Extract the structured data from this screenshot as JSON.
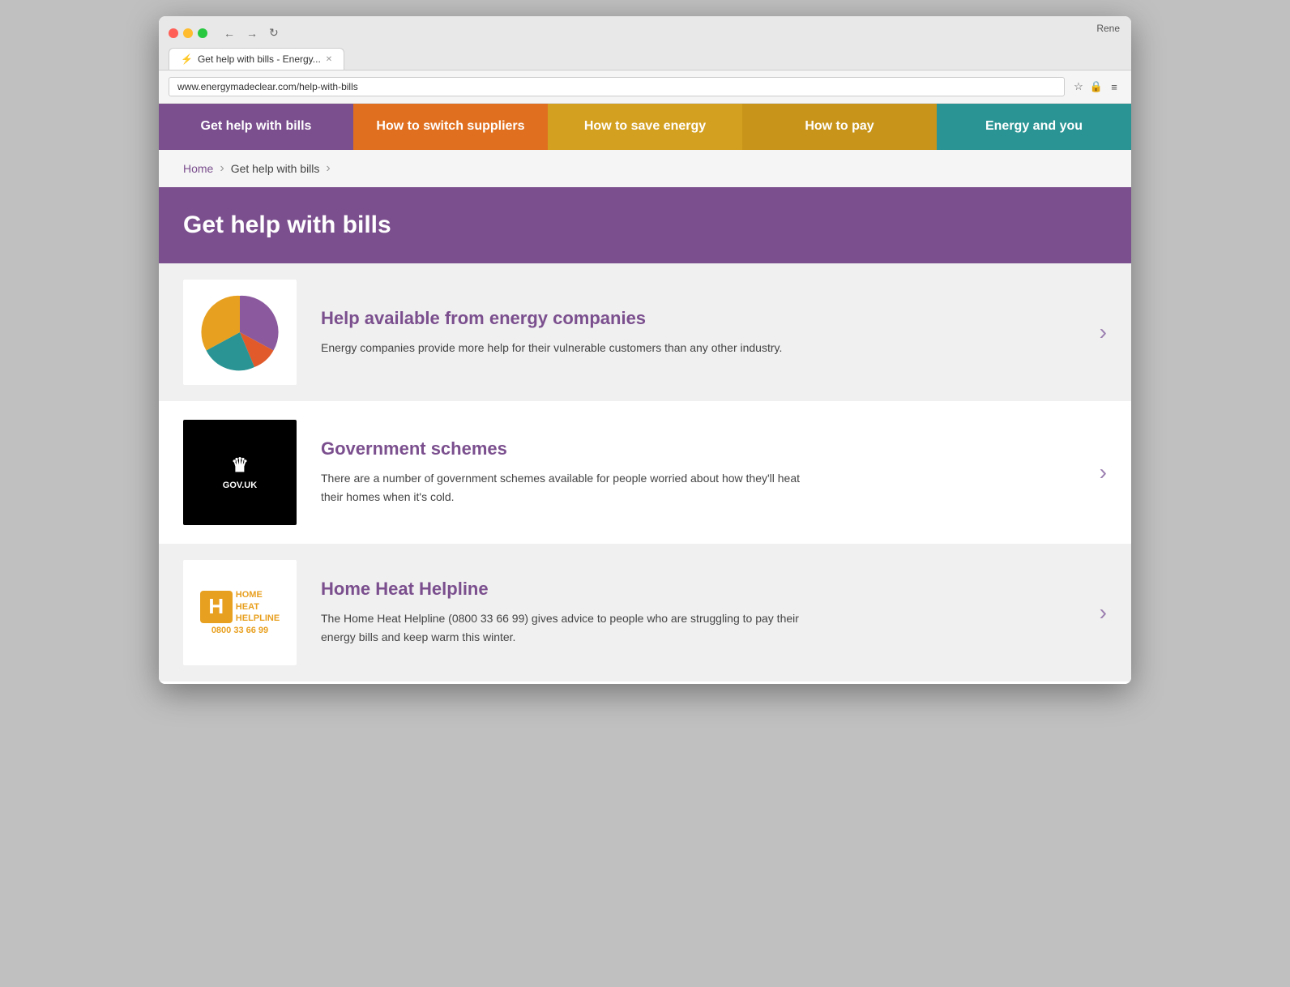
{
  "browser": {
    "tab_title": "Get help with bills - Energy...",
    "url": "www.energymadeclear.com/help-with-bills",
    "user": "Rene"
  },
  "nav": {
    "items": [
      {
        "id": "get-help",
        "label": "Get help with bills",
        "style": "active"
      },
      {
        "id": "switch",
        "label": "How to switch suppliers",
        "style": "orange"
      },
      {
        "id": "save",
        "label": "How to save energy",
        "style": "yellow"
      },
      {
        "id": "pay",
        "label": "How to pay",
        "style": "gold"
      },
      {
        "id": "energy-you",
        "label": "Energy and you",
        "style": "teal"
      }
    ]
  },
  "breadcrumb": {
    "home": "Home",
    "current": "Get help with bills"
  },
  "hero": {
    "title": "Get help with bills"
  },
  "cards": [
    {
      "id": "energy-companies",
      "title": "Help available from energy companies",
      "description": "Energy companies provide more help for their vulnerable customers than any other industry.",
      "image_type": "pie"
    },
    {
      "id": "government-schemes",
      "title": "Government schemes",
      "description": "There are a number of government schemes available for people worried about how they'll heat their homes when it's cold.",
      "image_type": "govuk"
    },
    {
      "id": "home-heat",
      "title": "Home Heat Helpline",
      "description": "The Home Heat Helpline (0800 33 66 99) gives advice to people who are struggling to pay their energy bills and keep warm this winter.",
      "image_type": "hhh"
    }
  ],
  "arrow_char": "›",
  "govuk_text": "GOV.UK",
  "hhh_number": "0800 33 66 99"
}
